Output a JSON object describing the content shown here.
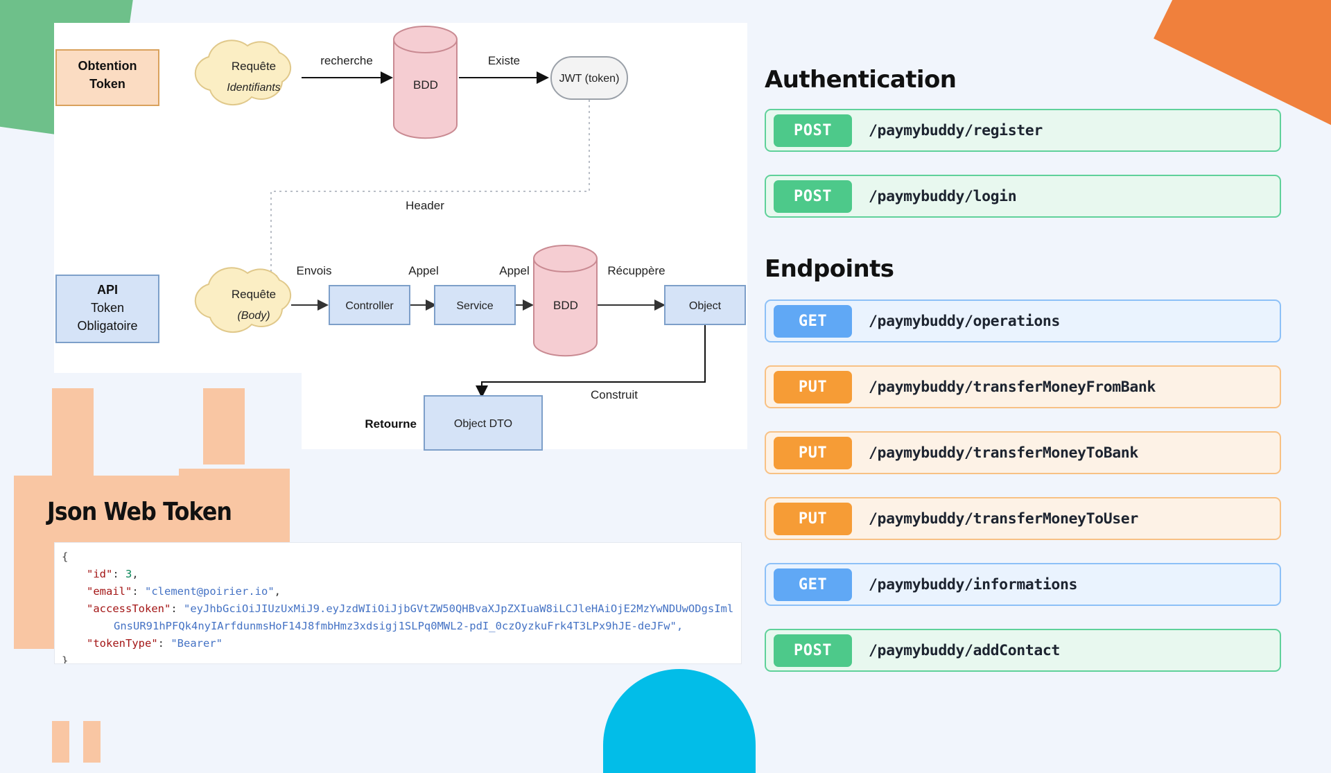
{
  "diagram": {
    "section_obtention": {
      "box_label_line1": "Obtention",
      "box_label_line2": "Token",
      "cloud_title": "Requête",
      "cloud_sub": "Identifiants",
      "edge_search": "recherche",
      "db_label": "BDD",
      "edge_exists": "Existe",
      "jwt_label": "JWT (token)"
    },
    "section_api": {
      "box_label_line1": "API",
      "box_label_line2": "Token",
      "box_label_line3": "Obligatoire",
      "header_label": "Header",
      "cloud_title": "Requête",
      "cloud_sub": "(Body)",
      "edge_envois": "Envois",
      "controller_label": "Controller",
      "edge_appel_1": "Appel",
      "service_label": "Service",
      "edge_appel_2": "Appel",
      "db_label": "BDD",
      "edge_recuppere": "Récuppère",
      "object_label": "Object",
      "edge_construit": "Construit",
      "dto_label": "Object DTO",
      "edge_retourne": "Retourne"
    }
  },
  "jwt": {
    "title": "Json Web Token",
    "json": {
      "open_brace": "{",
      "close_brace": "}",
      "id_key": "\"id\"",
      "id_value": "3",
      "email_key": "\"email\"",
      "email_value": "\"clement@poirier.io\"",
      "access_token_key": "\"accessToken\"",
      "access_token_line1": "\"eyJhbGciOiJIUzUxMiJ9.eyJzdWIiOiJjbGVtZW50QHBvaXJpZXIuaW8iLCJleHAiOjE2MzYwNDUwODgsIml",
      "access_token_line2": "GnsUR91hPFQk4nyIArfdunmsHoF14J8fmbHmz3xdsigj1SLPq0MWL2-pdI_0czOyzkuFrk4T3LPx9hJE-deJFw\",",
      "token_type_key": "\"tokenType\"",
      "token_type_value": "\"Bearer\"",
      "comma": ",",
      "colon": ":"
    }
  },
  "api_panel": {
    "auth_title": "Authentication",
    "endpoints_title": "Endpoints",
    "auth_endpoints": [
      {
        "method": "POST",
        "path": "/paymybuddy/register",
        "style": "m-post"
      },
      {
        "method": "POST",
        "path": "/paymybuddy/login",
        "style": "m-post"
      }
    ],
    "endpoints": [
      {
        "method": "GET",
        "path": "/paymybuddy/operations",
        "style": "m-get"
      },
      {
        "method": "PUT",
        "path": "/paymybuddy/transferMoneyFromBank",
        "style": "m-put"
      },
      {
        "method": "PUT",
        "path": "/paymybuddy/transferMoneyToBank",
        "style": "m-put"
      },
      {
        "method": "PUT",
        "path": "/paymybuddy/transferMoneyToUser",
        "style": "m-put"
      },
      {
        "method": "GET",
        "path": "/paymybuddy/informations",
        "style": "m-get"
      },
      {
        "method": "POST",
        "path": "/paymybuddy/addContact",
        "style": "m-post"
      }
    ]
  },
  "colors": {
    "background": "#f1f5fc",
    "green_shape": "#6ec08a",
    "orange_shape": "#f0803c",
    "peach_shape": "#f9c6a3",
    "cyan_shape": "#02bde8",
    "post": "#4dc98a",
    "get": "#60a8f5",
    "put": "#f69c36",
    "db_fill": "#f5cdd2",
    "box_blue_fill": "#d5e3f7",
    "cloud_fill": "#fbeec4",
    "obtention_fill": "#fbdcc2"
  }
}
